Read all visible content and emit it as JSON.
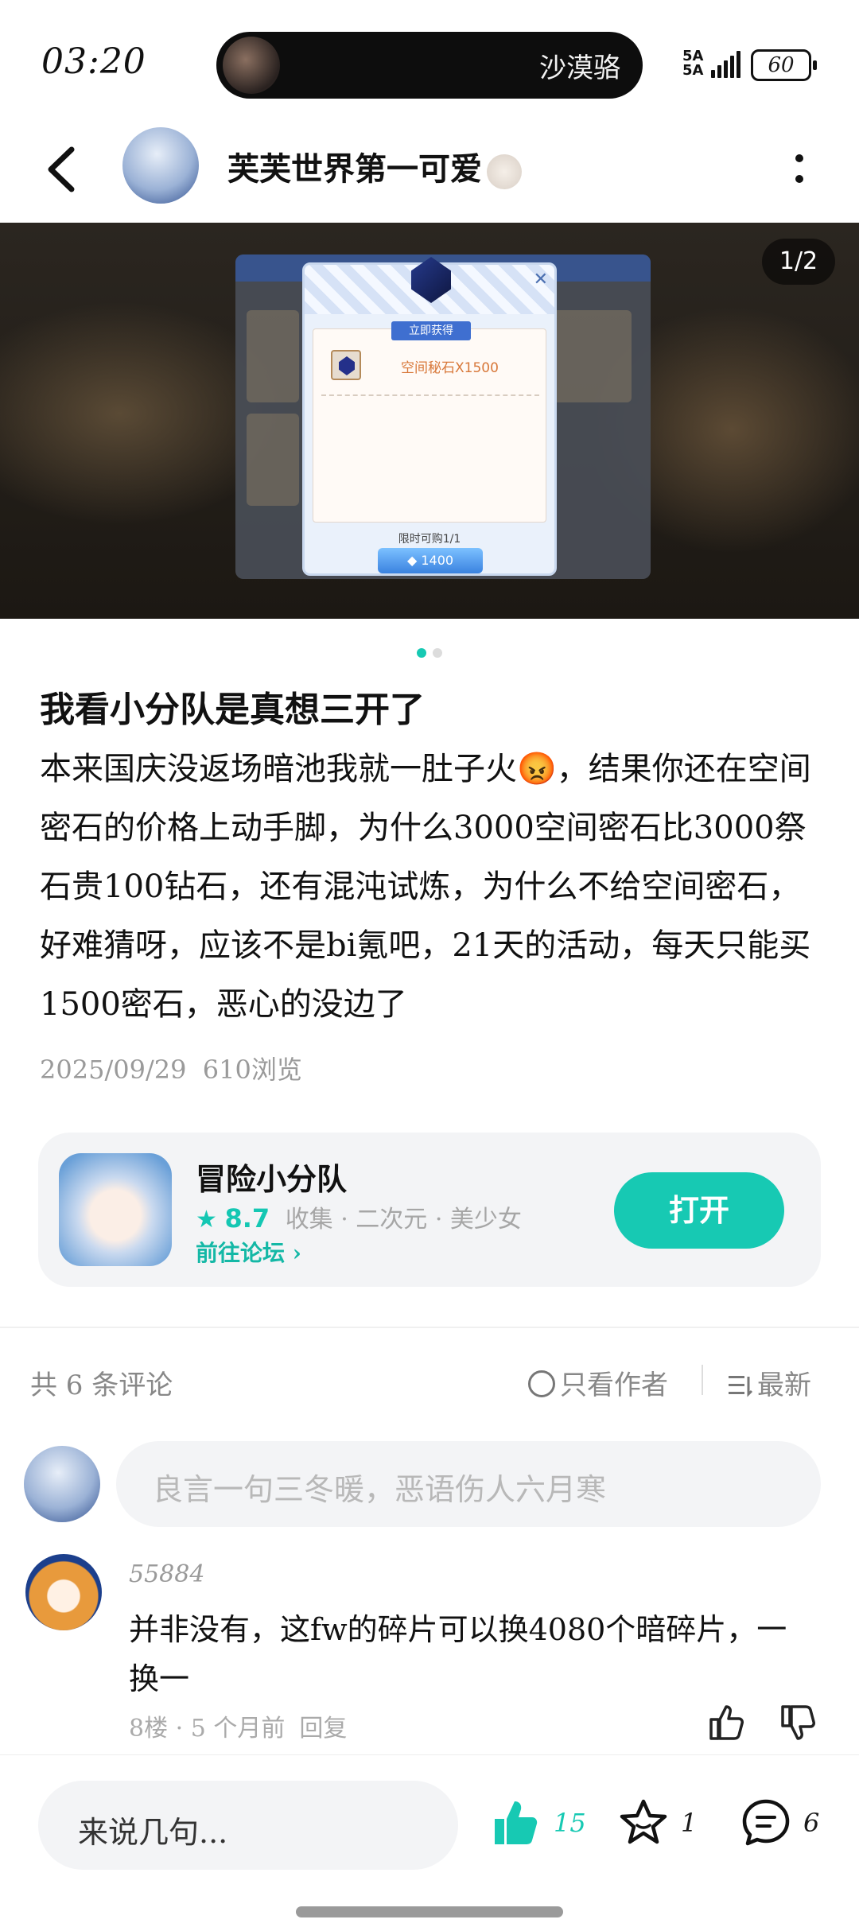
{
  "status_bar": {
    "time": "03:20",
    "now_playing": "沙漠骆",
    "network_label": "5A\n5A",
    "battery": "60"
  },
  "header": {
    "author_name": "芙芙世界第一可爱"
  },
  "carousel": {
    "page_indicator": "1/2",
    "active_index": 0,
    "total": 2,
    "screenshot": {
      "dialog_ribbon": "立即获得",
      "item_text": "空间秘石X1500",
      "limit_text": "限时可购1/1",
      "price": "1400"
    }
  },
  "post": {
    "title": "我看小分队是真想三开了",
    "body": "本来国庆没返场暗池我就一肚子火😡，结果你还在空间密石的价格上动手脚，为什么3000空间密石比3000祭石贵100钻石，还有混沌试炼，为什么不给空间密石，好难猜呀，应该不是bi氪吧，21天的活动，每天只能买1500密石，恶心的没边了",
    "date": "2025/09/29",
    "views": "610浏览"
  },
  "game_card": {
    "name": "冒险小分队",
    "rating": "8.7",
    "tags": "收集 · 二次元 · 美少女",
    "forum_link": "前往论坛",
    "open_label": "打开"
  },
  "comments": {
    "count_label": "共 6 条评论",
    "only_author_label": "只看作者",
    "sort_label": "最新",
    "input_placeholder": "良言一句三冬暖，恶语伤人六月寒",
    "items": [
      {
        "user": "55884",
        "text": "并非没有，这fw的碎片可以换4080个暗碎片，一换一",
        "meta": "8楼 · 5 个月前",
        "reply_label": "回复"
      }
    ]
  },
  "bottom_bar": {
    "input_placeholder": "来说几句...",
    "like_count": "15",
    "favorite_count": "1",
    "comment_count": "6"
  },
  "colors": {
    "accent": "#17c9b3",
    "accent_text": "#14b8a6",
    "muted_text": "#9a9a9a",
    "card_bg": "#f3f4f6"
  }
}
